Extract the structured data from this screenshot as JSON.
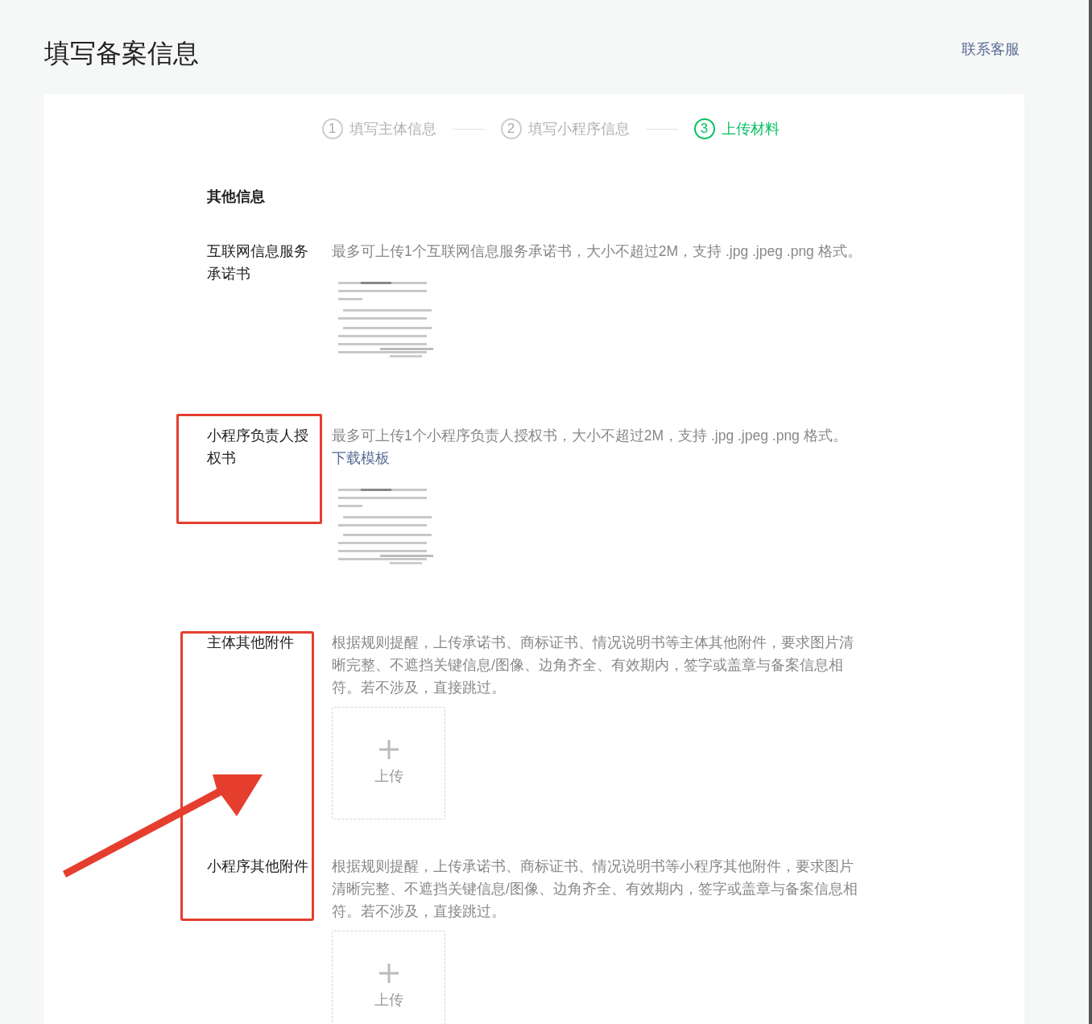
{
  "page_title": "填写备案信息",
  "contact_link": "联系客服",
  "steps": [
    {
      "number": "1",
      "label": "填写主体信息",
      "selected": false
    },
    {
      "number": "2",
      "label": "填写小程序信息",
      "selected": false
    },
    {
      "number": "3",
      "label": "上传材料",
      "selected": true
    }
  ],
  "section_title": "其他信息",
  "fields": [
    {
      "label": "互联网信息服务承诺书",
      "description": "最多可上传1个互联网信息服务承诺书，大小不超过2M，支持 .jpg .jpeg .png 格式。"
    },
    {
      "label": "小程序负责人授权书",
      "description": "最多可上传1个小程序负责人授权书，大小不超过2M，支持 .jpg .jpeg .png 格式。",
      "link": "下载模板"
    },
    {
      "label": "主体其他附件",
      "description": "根据规则提醒，上传承诺书、商标证书、情况说明书等主体其他附件，要求图片清晰完整、不遮挡关键信息/图像、边角齐全、有效期内，签字或盖章与备案信息相符。若不涉及，直接跳过。",
      "attachment": {
        "kind": "upload",
        "label": "上传"
      }
    },
    {
      "label": "小程序其他附件",
      "description": "根据规则提醒，上传承诺书、商标证书、情况说明书等小程序其他附件，要求图片清晰完整、不遮挡关键信息/图像、边角齐全、有效期内，签字或盖章与备案信息相符。若不涉及，直接跳过。",
      "attachment": {
        "kind": "upload",
        "label": "上传"
      }
    }
  ]
}
